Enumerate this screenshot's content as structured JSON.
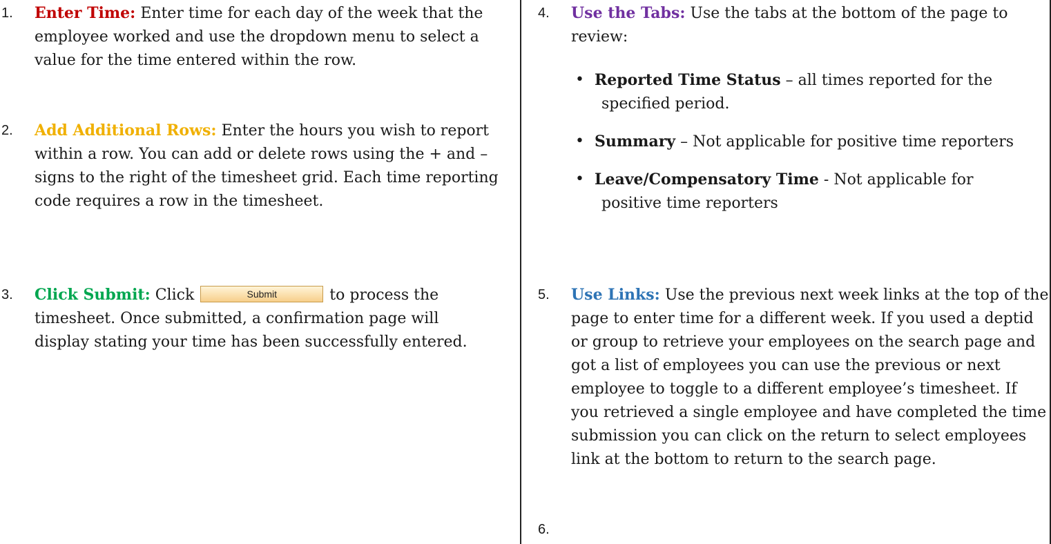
{
  "left_steps": [
    {
      "num": "1.",
      "heading": "Enter Time:",
      "text": "Enter time for each day of  the week that the employee worked and use the dropdown menu to select a value for the time entered within the row."
    },
    {
      "num": "2.",
      "heading": "Add Additional Rows:",
      "text": "Enter the hours you wish to report within a row.  You can add or delete rows using the + and – signs to the right of the timesheet grid.  Each time reporting code requires a row in the timesheet."
    },
    {
      "num": "3.",
      "heading": "Click Submit:",
      "text_before": "Click",
      "button_label": "Submit",
      "text_after": "to process the timesheet.  Once submitted, a confirmation page will display stating your time has been successfully entered."
    }
  ],
  "right_steps": {
    "step4": {
      "num": "4.",
      "heading": "Use the Tabs:",
      "text": "Use the tabs at the bottom of the page to review:",
      "bullets": [
        {
          "name": "Reported Time Status",
          "sep": " – ",
          "line1": "all times reported for the",
          "line2": "specified period."
        },
        {
          "name": "Summary",
          "sep": " – ",
          "line1": "Not applicable for positive time reporters",
          "line2": ""
        },
        {
          "name": "Leave/Compensatory Time",
          "sep": " - ",
          "line1": "Not applicable for",
          "line2": "positive time reporters"
        }
      ]
    },
    "step5": {
      "num": "5.",
      "heading": "Use Links:",
      "text": "Use the previous next week links at the top of the page to enter time for a different week.  If you used a deptid or group to retrieve your employees on the search page and got a list of employees you can use the previous or next employee to toggle to a different employee’s timesheet.  If you retrieved a single employee and have completed the time submission you can click on the return to select employees link at the bottom to return to the search page."
    },
    "step6": {
      "num": "6."
    }
  },
  "colors": {
    "enter_time": "#c00000",
    "add_rows": "#f0b000",
    "click_submit": "#00a64f",
    "use_tabs": "#7030a0",
    "use_links": "#2e74b5"
  }
}
